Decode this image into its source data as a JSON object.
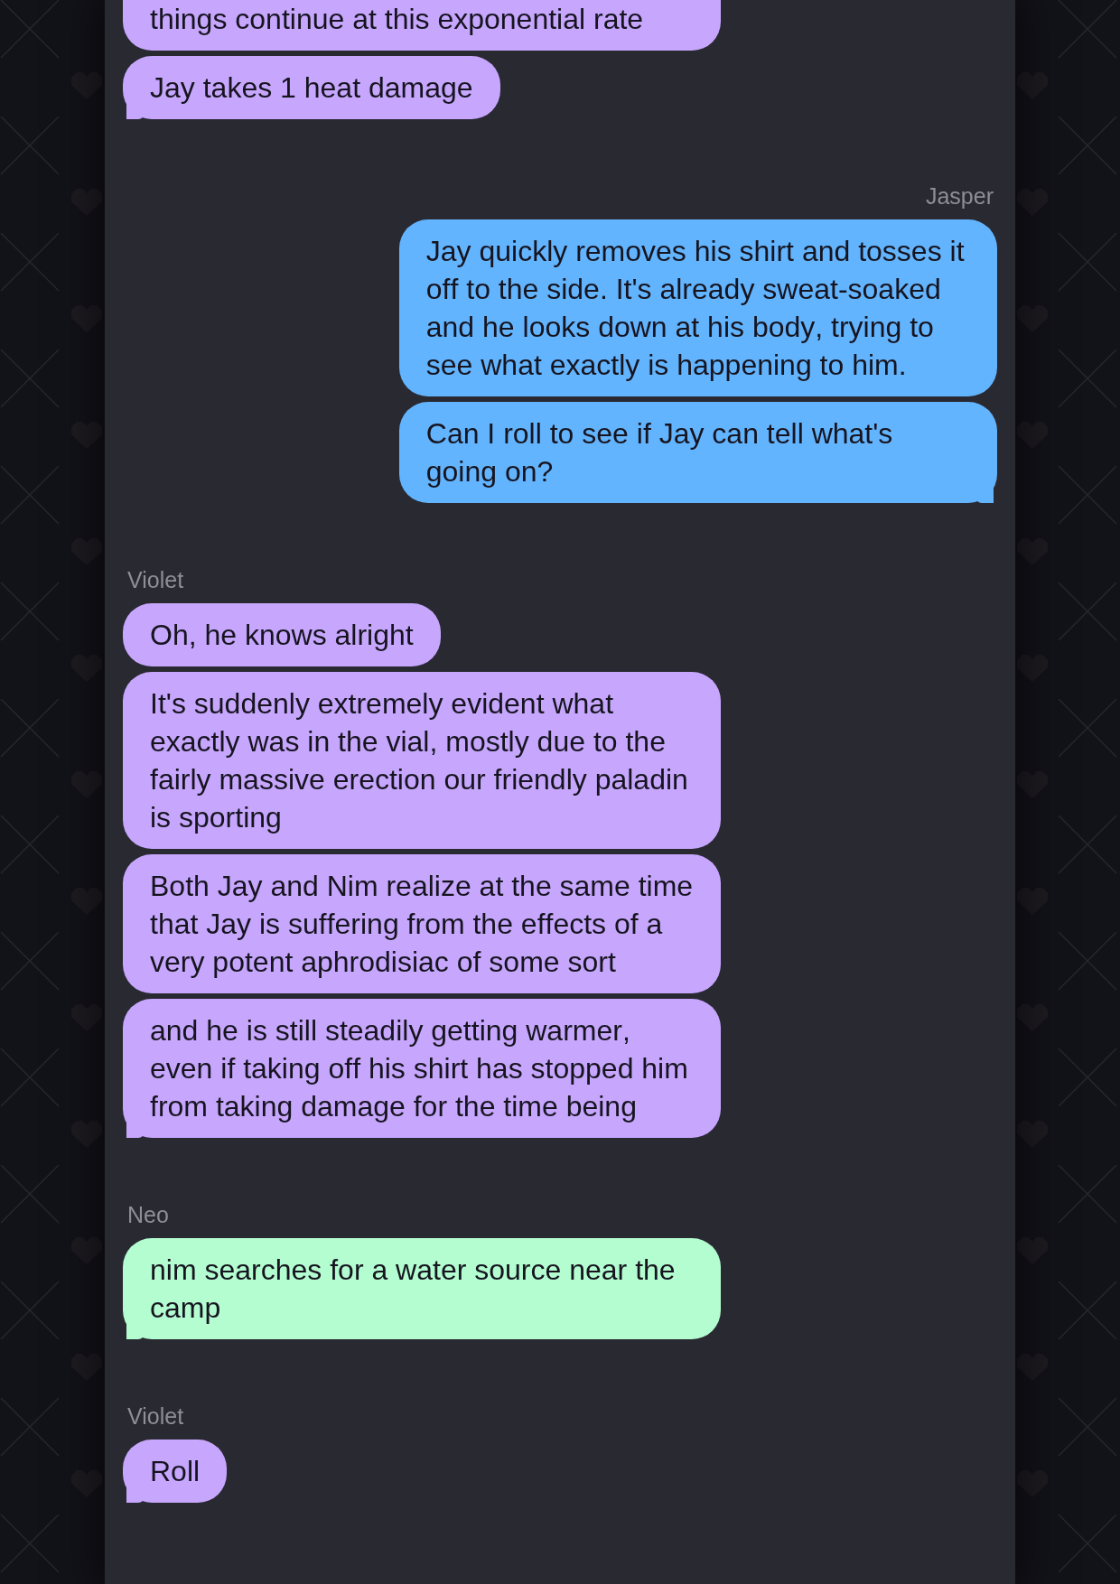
{
  "conversation": {
    "groups": [
      {
        "kind": "received",
        "color": "#c7a7fe",
        "messages": [
          "things continue at this exponential rate",
          "Jay takes 1 heat damage"
        ]
      },
      {
        "kind": "sent",
        "sender": "Jasper",
        "color": "#63b4fe",
        "messages": [
          "Jay quickly removes his shirt and tosses it off to the side. It's already sweat-soaked and he looks down at his body, trying to see what exactly is happening to him.",
          "Can I roll to see if Jay can tell what's going on?"
        ]
      },
      {
        "kind": "received",
        "sender": "Violet",
        "color": "#c7a7fe",
        "messages": [
          "Oh, he knows alright",
          "It's suddenly extremely evident what exactly was in the vial, mostly due to the fairly massive erection our friendly paladin is sporting",
          "Both Jay and Nim realize at the same time that Jay is suffering from the effects of a very potent aphrodisiac of some sort",
          "and he is still steadily getting warmer, even if taking off his shirt has stopped him from taking damage for the time being"
        ]
      },
      {
        "kind": "received",
        "sender": "Neo",
        "color": "#b3fdd0",
        "messages": [
          "nim searches for a water source near the camp"
        ]
      },
      {
        "kind": "received",
        "sender": "Violet",
        "color": "#c7a7fe",
        "messages": [
          "Roll"
        ]
      }
    ]
  }
}
